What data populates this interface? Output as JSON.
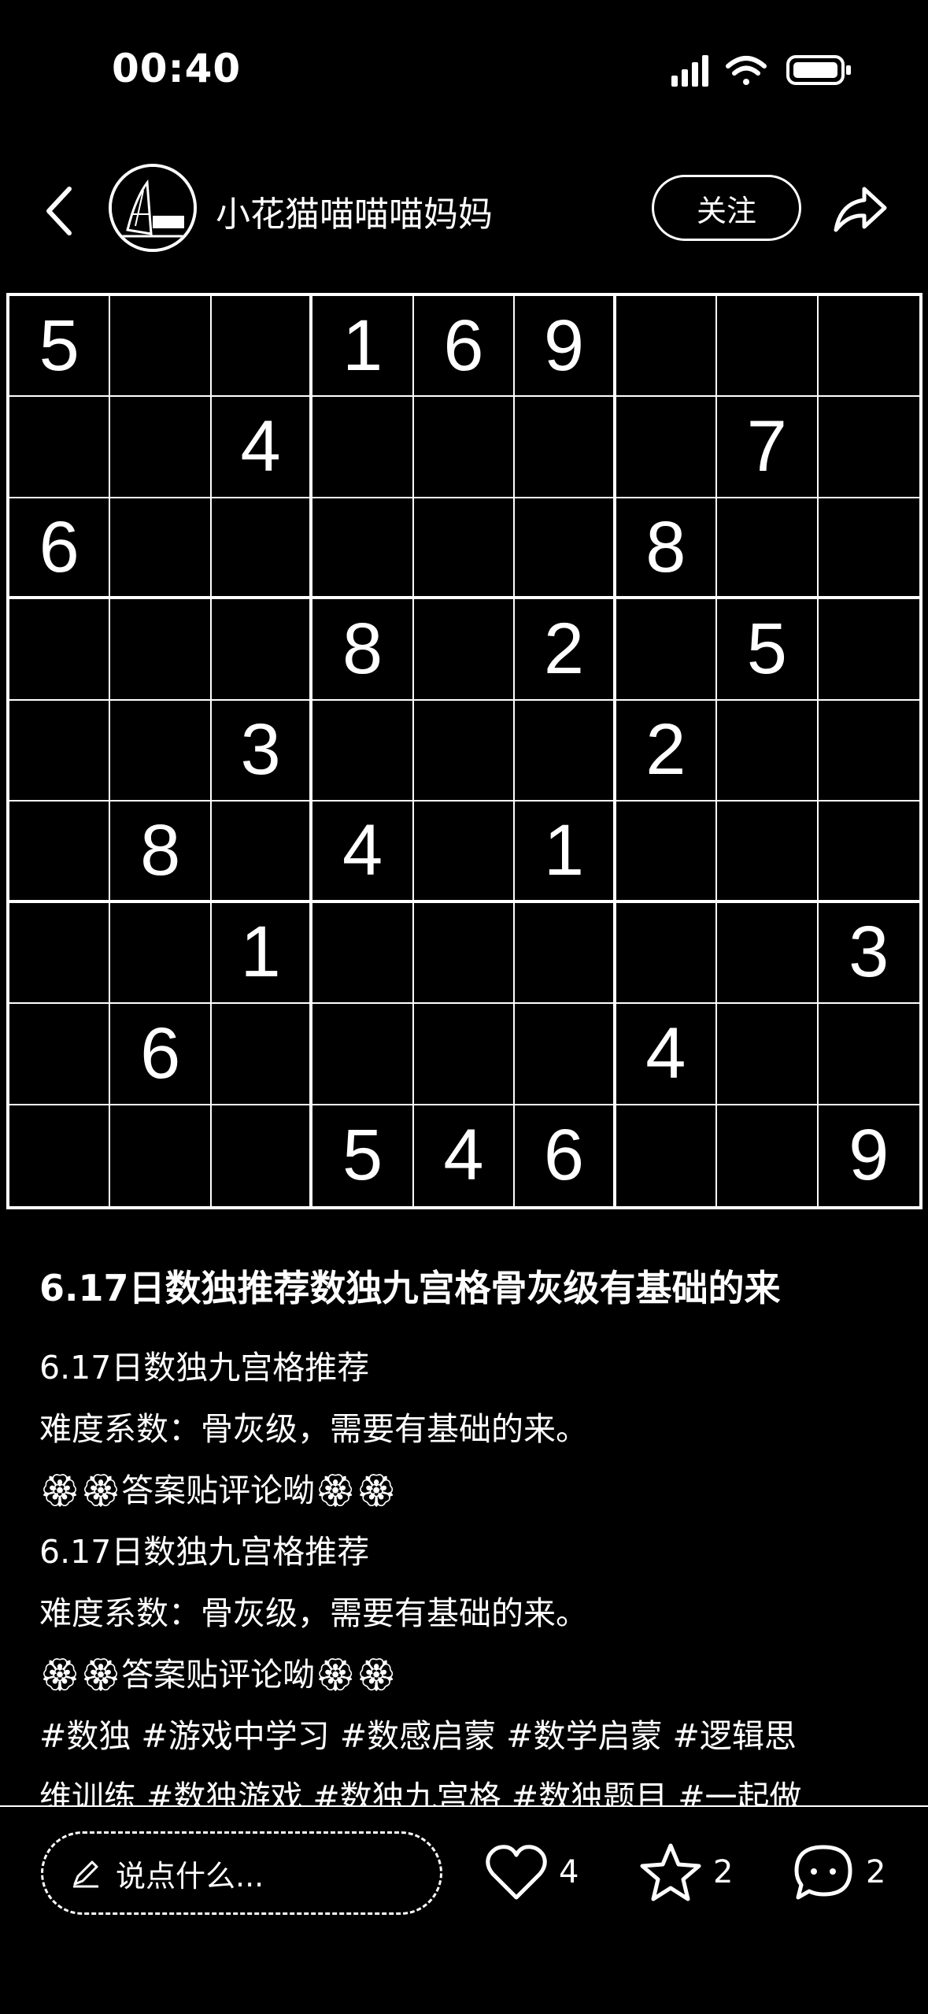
{
  "status_bar": {
    "time": "00:40",
    "icons": [
      "cellular-signal-icon",
      "wifi-icon",
      "battery-icon"
    ]
  },
  "header": {
    "username": "小花猫喵喵喵妈妈",
    "follow_label": "关注",
    "icons": [
      "back-icon",
      "avatar",
      "share-icon"
    ]
  },
  "sudoku": {
    "rows": [
      [
        "5",
        "",
        "",
        "1",
        "6",
        "9",
        "",
        "",
        ""
      ],
      [
        "",
        "",
        "4",
        "",
        "",
        "",
        "",
        "7",
        ""
      ],
      [
        "6",
        "",
        "",
        "",
        "",
        "",
        "8",
        "",
        ""
      ],
      [
        "",
        "",
        "",
        "8",
        "",
        "2",
        "",
        "5",
        ""
      ],
      [
        "",
        "",
        "3",
        "",
        "",
        "",
        "2",
        "",
        ""
      ],
      [
        "",
        "8",
        "",
        "4",
        "",
        "1",
        "",
        "",
        ""
      ],
      [
        "",
        "",
        "1",
        "",
        "",
        "",
        "",
        "",
        "3"
      ],
      [
        "",
        "6",
        "",
        "",
        "",
        "",
        "4",
        "",
        ""
      ],
      [
        "",
        "",
        "",
        "5",
        "4",
        "6",
        "",
        "",
        "9"
      ]
    ]
  },
  "post": {
    "title": "6.17日数独推荐数独九宫格骨灰级有基础的来",
    "lines": [
      "6.17日数独九宫格推荐",
      "难度系数：骨灰级，需要有基础的来。",
      "🏵🏵答案贴评论呦🏵🏵",
      "6.17日数独九宫格推荐",
      "难度系数：骨灰级，需要有基础的来。",
      "🏵🏵答案贴评论呦🏵🏵",
      "#数独 #游戏中学习 #数感启蒙 #数学启蒙 #逻辑思",
      "维训练 #数独游戏 #数独九宫格 #数独题目 #一起做"
    ]
  },
  "bottom_bar": {
    "comment_placeholder": "说点什么...",
    "like_count": "4",
    "favorite_count": "2",
    "comment_count": "2"
  }
}
